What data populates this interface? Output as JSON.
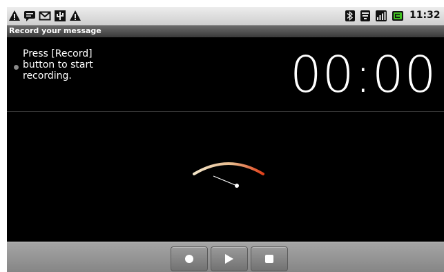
{
  "status_bar": {
    "clock": "11:32 am",
    "icons_left": [
      "warning-icon",
      "chat-icon",
      "gmail-icon",
      "usb-debug-icon",
      "warning-icon"
    ],
    "icons_right": [
      "bluetooth-icon",
      "wifi-icon",
      "signal-icon",
      "battery-icon"
    ]
  },
  "title_bar": {
    "title": "Record your message"
  },
  "message": {
    "text": "Press [Record] button to start recording."
  },
  "timer": {
    "value": "00:00"
  },
  "controls": {
    "buttons": [
      "record",
      "play",
      "stop"
    ]
  },
  "colors": {
    "background": "#000000",
    "meter_start": "#f2e4c8",
    "meter_end": "#e0401a",
    "battery_green": "#3fbf1f"
  }
}
